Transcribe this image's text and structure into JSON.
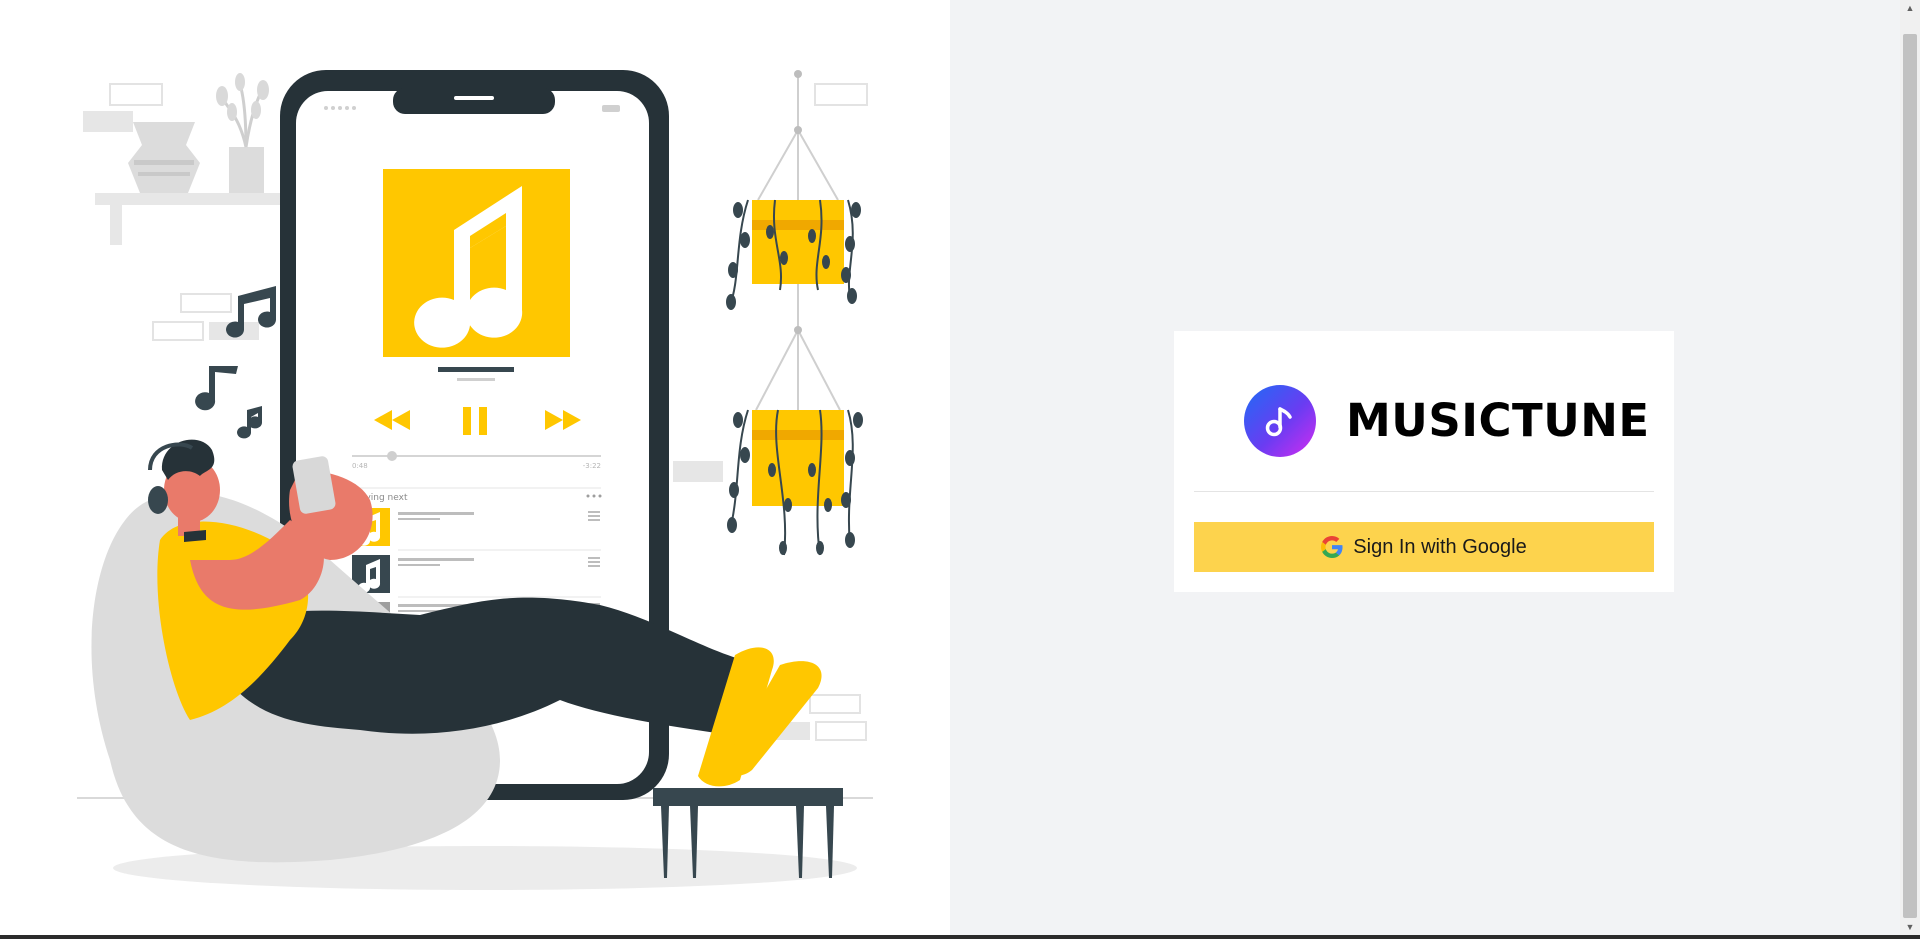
{
  "brand": {
    "name": "MUSICTUNE",
    "logo_icon": "music-note-icon"
  },
  "auth": {
    "google_button_label": "Sign In with Google",
    "google_icon": "google-g-icon"
  },
  "illustration": {
    "subject": "person listening to music on phone",
    "phone_screen": {
      "time_elapsed": "0:48",
      "time_remaining": "-3:22",
      "queue_heading": "Playing next"
    }
  },
  "colors": {
    "accent_yellow": "#fdd34d",
    "art_yellow": "#ffc700",
    "art_dark": "#263238",
    "skin": "#e97a6a",
    "right_bg": "#f2f3f5"
  }
}
